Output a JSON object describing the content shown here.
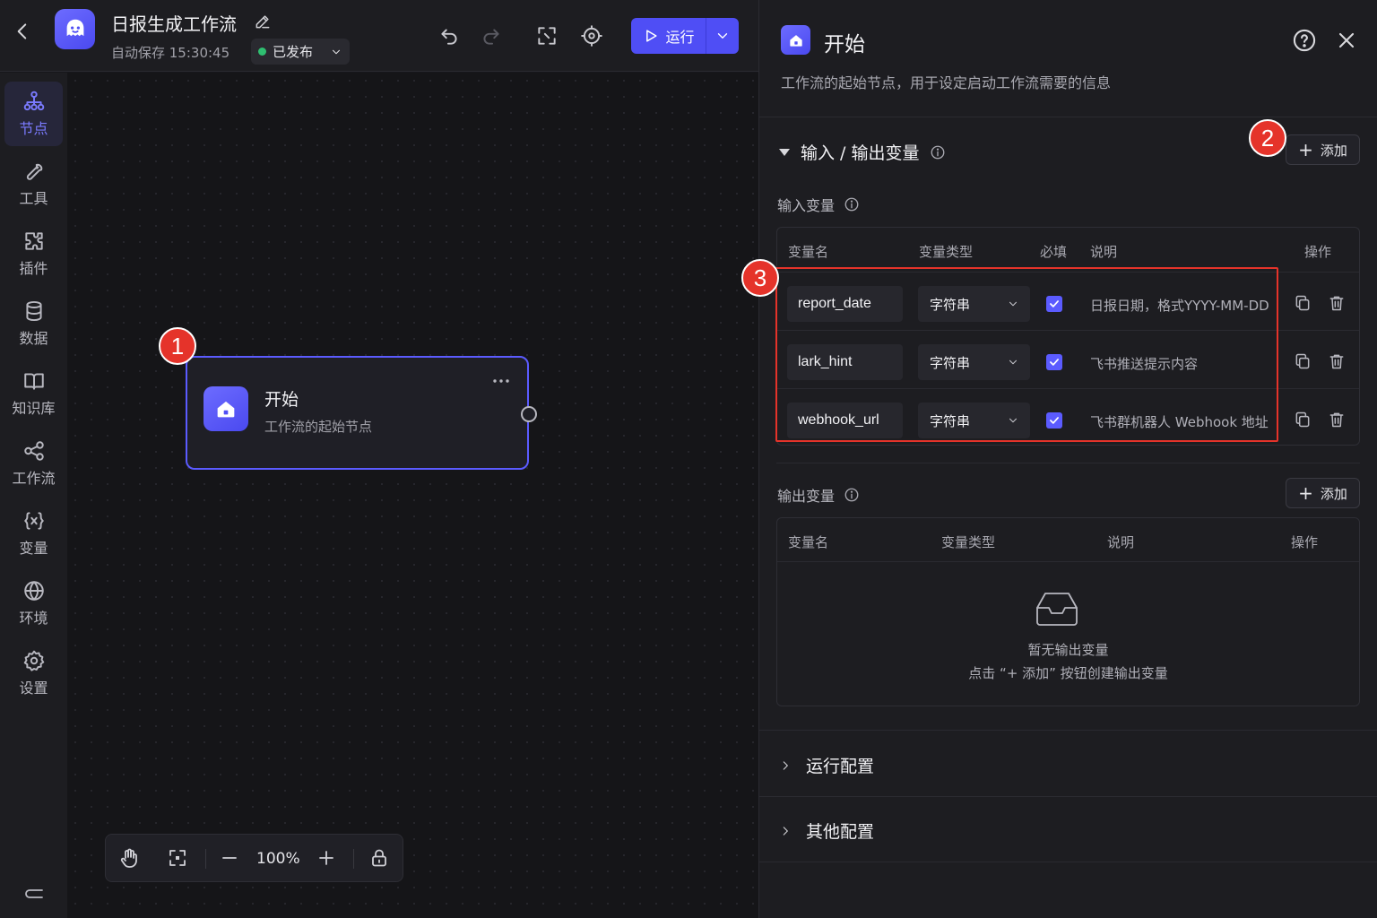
{
  "app": {
    "workflow_title": "日报生成工作流",
    "autosave": "自动保存 15:30:45",
    "publish_status": "已发布",
    "run_label": "运行",
    "status_color": "#2fbf71",
    "accent_color": "#5b5bff"
  },
  "rail": {
    "items": [
      {
        "label": "节点",
        "icon": "nodes-icon",
        "active": true
      },
      {
        "label": "工具",
        "icon": "wrench-icon"
      },
      {
        "label": "插件",
        "icon": "puzzle-icon"
      },
      {
        "label": "数据",
        "icon": "database-icon"
      },
      {
        "label": "知识库",
        "icon": "book-icon"
      },
      {
        "label": "工作流",
        "icon": "share-icon"
      },
      {
        "label": "变量",
        "icon": "variable-icon"
      },
      {
        "label": "环境",
        "icon": "globe-icon"
      },
      {
        "label": "设置",
        "icon": "gear-icon"
      }
    ]
  },
  "canvas": {
    "node_title": "开始",
    "node_desc": "工作流的起始节点",
    "zoom_level": "100%"
  },
  "markers": [
    "1",
    "2",
    "3"
  ],
  "panel": {
    "title": "开始",
    "desc": "工作流的起始节点，用于设定启动工作流需要的信息",
    "io_section_title": "输入 / 输出变量",
    "add_label": "添加",
    "input_title": "输入变量",
    "output_title": "输出变量",
    "input_headers": {
      "name": "变量名",
      "type": "变量类型",
      "required": "必填",
      "desc": "说明",
      "actions": "操作"
    },
    "input_rows": [
      {
        "name": "report_date",
        "type": "字符串",
        "required": true,
        "desc": "日报日期，格式YYYY-MM-DD"
      },
      {
        "name": "lark_hint",
        "type": "字符串",
        "required": true,
        "desc": "飞书推送提示内容"
      },
      {
        "name": "webhook_url",
        "type": "字符串",
        "required": true,
        "desc": "飞书群机器人 Webhook 地址"
      }
    ],
    "output_headers": {
      "name": "变量名",
      "type": "变量类型",
      "desc": "说明",
      "actions": "操作"
    },
    "empty_title": "暂无输出变量",
    "empty_hint": "点击 “+ 添加” 按钮创建输出变量",
    "run_config": "运行配置",
    "other_config": "其他配置"
  }
}
